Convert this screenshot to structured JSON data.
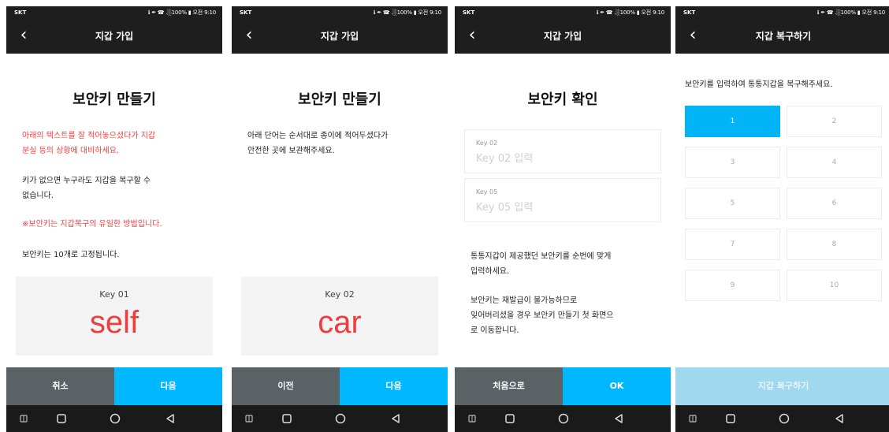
{
  "status": {
    "carrier": "SKT",
    "info": "ℹ ✒ ☎ .░100% ▮ 오전 9:10"
  },
  "screen1": {
    "title": "지갑 가입",
    "heading": "보안키 만들기",
    "warning": "아래의 텍스트를 잘 적어놓으셨다가 지갑\n분실 등의 상황에 대비하세요.",
    "info1": "키가 없으면 누구라도 지갑을 복구할 수\n없습니다.",
    "notice": "※보안키는 지갑복구의 유일한 방법입니다.",
    "info2": "보안키는 10개로 고정됩니다.",
    "key_label": "Key 01",
    "key_word": "self",
    "btn_left": "취소",
    "btn_right": "다음"
  },
  "screen2": {
    "title": "지갑 가입",
    "heading": "보안키 만들기",
    "info": "아래 단어는 순서대로 종이에 적어두셨다가\n안전한 곳에 보관해주세요.",
    "key_label": "Key 02",
    "key_word": "car",
    "btn_left": "이전",
    "btn_right": "다음"
  },
  "screen3": {
    "title": "지갑 가입",
    "heading": "보안키 확인",
    "field1_label": "Key 02",
    "field1_placeholder": "Key 02 입력",
    "field2_label": "Key 05",
    "field2_placeholder": "Key 05 입력",
    "info1": "통통지갑이 제공했던 보안키를 순번에 맞게\n입력하세요.",
    "info2": "보안키는 재발급이 불가능하므로\n잊어버리셨을 경우 보안키 만들기 첫 화면으\n로 이동합니다.",
    "btn_left": "처음으로",
    "btn_right": "OK"
  },
  "screen4": {
    "title": "지갑 복구하기",
    "info": "보안키를 입력하여 통통지갑을 복구해주세요.",
    "cells": [
      "1",
      "2",
      "3",
      "4",
      "5",
      "6",
      "7",
      "8",
      "9",
      "10"
    ],
    "active_cell": "1",
    "btn": "지갑 복구하기"
  },
  "icons": {
    "back": "back-arrow-icon",
    "nav": [
      "menu-icon",
      "home-icon",
      "circle-icon",
      "back-triangle-icon"
    ]
  },
  "colors": {
    "accent": "#00b8ff",
    "warning": "#ff3b3b",
    "key_word": "#f03c3c",
    "dark": "#1e1e1e",
    "gray_button": "#5a6266"
  }
}
